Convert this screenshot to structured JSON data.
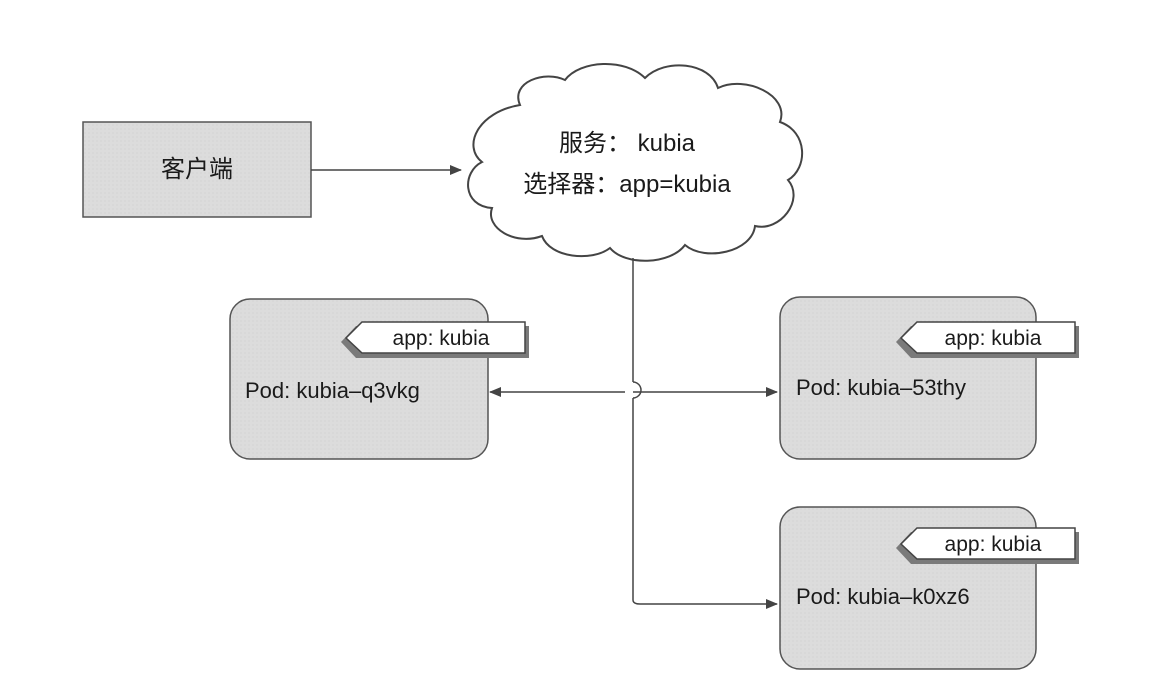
{
  "client": {
    "label": "客户端"
  },
  "service": {
    "name_line": "服务： kubia",
    "selector_line": "选择器：app=kubia"
  },
  "pods": [
    {
      "label_tag": "app: kubia",
      "name": "Pod: kubia–q3vkg"
    },
    {
      "label_tag": "app: kubia",
      "name": "Pod: kubia–53thy"
    },
    {
      "label_tag": "app: kubia",
      "name": "Pod: kubia–k0xz6"
    }
  ],
  "colors": {
    "box_fill": "#dcdcdc",
    "box_stroke": "#555555",
    "line": "#444444",
    "tag_fill": "#ffffff",
    "tag_shadow": "#7a7a7a"
  }
}
